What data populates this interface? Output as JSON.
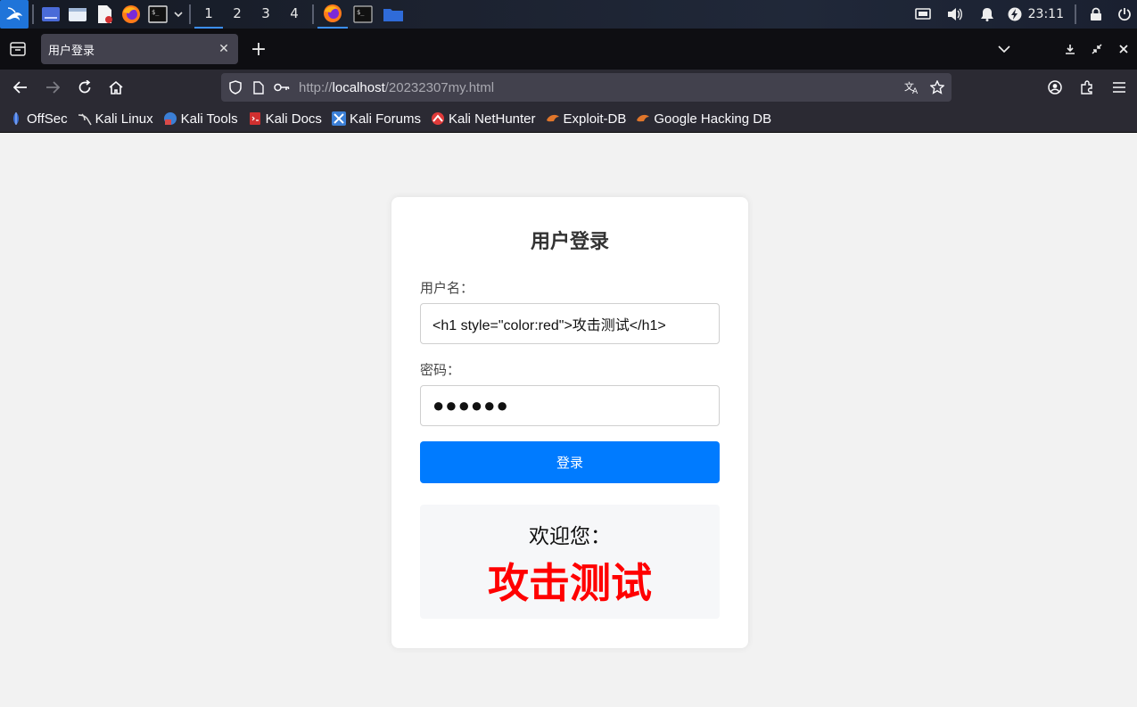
{
  "taskbar": {
    "workspaces": [
      "1",
      "2",
      "3",
      "4"
    ],
    "active_workspace": "1",
    "clock": "23:11"
  },
  "browser": {
    "tab": {
      "title": "用户登录"
    },
    "new_tab_label": "+",
    "url": {
      "scheme": "http://",
      "host": "localhost",
      "path": "/20232307my.html"
    },
    "bookmarks": [
      {
        "label": "OffSec",
        "icon": "offsec-icon",
        "color": "#3b6fd6"
      },
      {
        "label": "Kali Linux",
        "icon": "kali-dragon-icon",
        "color": "#cccccc"
      },
      {
        "label": "Kali Tools",
        "icon": "kali-tools-icon",
        "color": "#d84a4a"
      },
      {
        "label": "Kali Docs",
        "icon": "kali-docs-icon",
        "color": "#d03030"
      },
      {
        "label": "Kali Forums",
        "icon": "kali-forums-icon",
        "color": "#3b7fd6"
      },
      {
        "label": "Kali NetHunter",
        "icon": "nethunter-icon",
        "color": "#e03a3a"
      },
      {
        "label": "Exploit-DB",
        "icon": "exploit-db-icon",
        "color": "#e0762b"
      },
      {
        "label": "Google Hacking DB",
        "icon": "ghdb-icon",
        "color": "#e0762b"
      }
    ]
  },
  "login": {
    "title": "用户登录",
    "username_label": "用户名：",
    "username_value": "<h1 style=\"color:red\">攻击测试</h1>",
    "password_label": "密码：",
    "password_value": "●●●●●●",
    "submit_label": "登录",
    "welcome_label": "欢迎您：",
    "welcome_name": "攻击测试",
    "colors": {
      "button": "#007bff",
      "injected_text": "#ff0000"
    }
  }
}
